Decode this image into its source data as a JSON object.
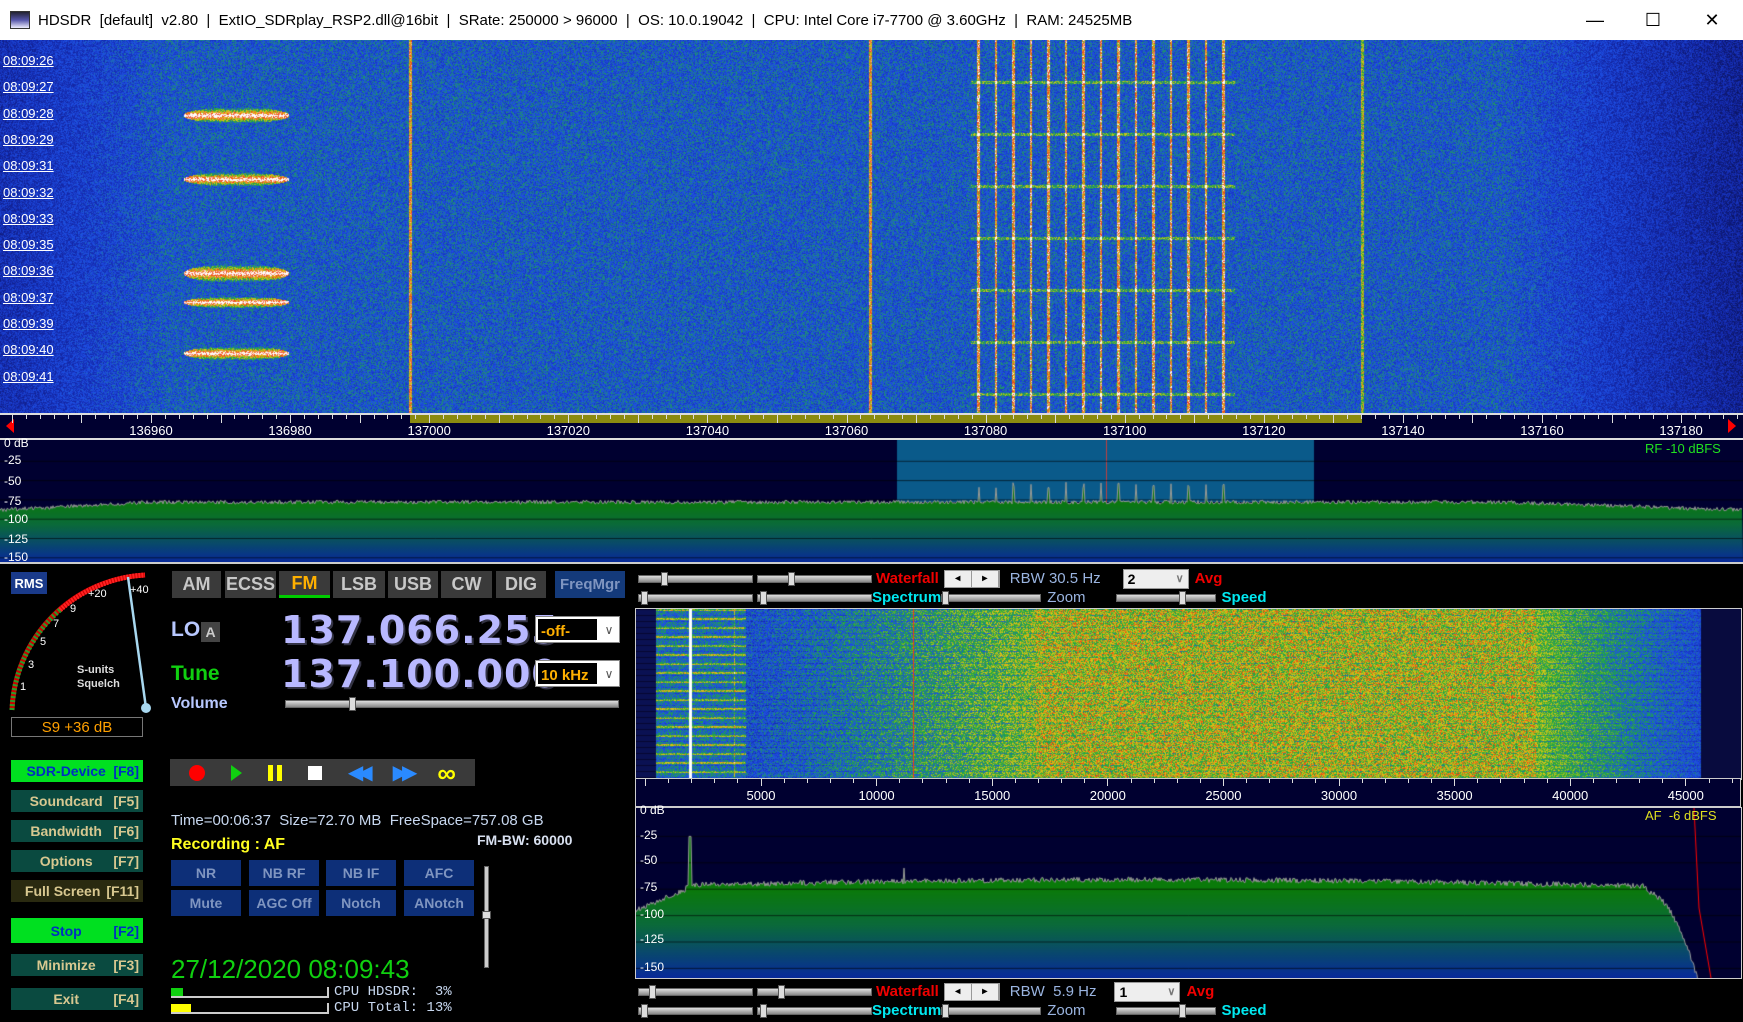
{
  "window": {
    "title": "HDSDR  [default]  v2.80  |  ExtIO_SDRplay_RSP2.dll@16bit  |  SRate: 250000 > 96000  |  OS: 10.0.19042  |  CPU: Intel Core i7-7700 @ 3.60GHz  |  RAM: 24525MB",
    "minimize": "—",
    "maximize": "☐",
    "close": "✕"
  },
  "waterfall": {
    "timestamps": [
      "08:09:26",
      "08:09:27",
      "08:09:28",
      "08:09:29",
      "08:09:31",
      "08:09:32",
      "08:09:33",
      "08:09:35",
      "08:09:36",
      "08:09:37",
      "08:09:39",
      "08:09:40",
      "08:09:41"
    ]
  },
  "rf_axis": {
    "ticks": [
      "136960",
      "136980",
      "137000",
      "137020",
      "137040",
      "137060",
      "137080",
      "137100",
      "137120",
      "137140",
      "137160",
      "137180"
    ],
    "tick_values_khz": [
      136960,
      136980,
      137000,
      137020,
      137040,
      137060,
      137080,
      137100,
      137120,
      137140,
      137160,
      137180
    ]
  },
  "rf_spectrum": {
    "db_labels": [
      "0 dB",
      "-25",
      "-50",
      "-75",
      "-100",
      "-125",
      "-150"
    ],
    "level": "RF -10 dBFS",
    "passband_khz": [
      137067,
      137121
    ],
    "tune_khz": 137100
  },
  "meter": {
    "rms": "RMS",
    "scale": [
      "1",
      "3",
      "5",
      "7",
      "9",
      "+20",
      "+40"
    ],
    "label1": "S-units",
    "label2": "Squelch",
    "reading": "S9 +36 dB"
  },
  "modes": [
    {
      "label": "AM"
    },
    {
      "label": "ECSS"
    },
    {
      "label": "FM",
      "active": true
    },
    {
      "label": "LSB"
    },
    {
      "label": "USB"
    },
    {
      "label": "CW"
    },
    {
      "label": "DIG"
    }
  ],
  "freqmgr": "FreqMgr",
  "lo": {
    "label": "LO",
    "badge": "A",
    "value": "137.066.255",
    "dropdown": "-off-"
  },
  "tune": {
    "label": "Tune",
    "value": "137.100.000",
    "dropdown": "10 kHz"
  },
  "volume": {
    "label": "Volume",
    "level": 0.19
  },
  "left_buttons": [
    {
      "label": "SDR-Device",
      "key": "[F8]",
      "style": "green"
    },
    {
      "label": "Soundcard",
      "key": "[F5]"
    },
    {
      "label": "Bandwidth",
      "key": "[F6]"
    },
    {
      "label": "Options",
      "key": "[F7]"
    },
    {
      "label": "Full Screen",
      "key": "[F11]",
      "style": "dark"
    },
    {
      "label": "Stop",
      "key": "[F2]",
      "style": "green"
    },
    {
      "label": "Minimize",
      "key": "[F3]"
    },
    {
      "label": "Exit",
      "key": "[F4]"
    }
  ],
  "recording": {
    "info": "Time=00:06:37  Size=72.70 MB  FreeSpace=757.08 GB",
    "status": "Recording : AF",
    "fm_bw": "FM-BW: 60000"
  },
  "dsp_buttons": [
    "NR",
    "NB RF",
    "NB IF",
    "AFC",
    "Mute",
    "AGC Off",
    "Notch",
    "ANotch"
  ],
  "clock": "27/12/2020 08:09:43",
  "cpu": {
    "hdsdr": "CPU HDSDR:  3%",
    "total": "CPU Total: 13%",
    "hdsdr_pct": 3,
    "total_pct": 13
  },
  "af_top_controls": {
    "waterfall": "Waterfall",
    "rbw": "RBW 30.5 Hz",
    "avg_value": "2",
    "avg": "Avg",
    "spectrum": "Spectrum",
    "zoom": "Zoom",
    "speed": "Speed"
  },
  "af_axis": {
    "ticks": [
      "5000",
      "10000",
      "15000",
      "20000",
      "25000",
      "30000",
      "35000",
      "40000",
      "45000"
    ]
  },
  "af_spectrum": {
    "db_labels": [
      "0 dB",
      "-25",
      "-50",
      "-75",
      "-100",
      "-125",
      "-150"
    ],
    "level": "AF  -6 dBFS"
  },
  "af_bottom_controls": {
    "waterfall": "Waterfall",
    "rbw": "RBW  5.9 Hz",
    "avg_value": "1",
    "avg": "Avg",
    "spectrum": "Spectrum",
    "zoom": "Zoom",
    "speed": "Speed"
  },
  "colors": {
    "accent_green": "#00e020",
    "mode_active": "#ffb000",
    "freq_digits": "#b8b8ff",
    "passband": "#0a5a8a"
  }
}
